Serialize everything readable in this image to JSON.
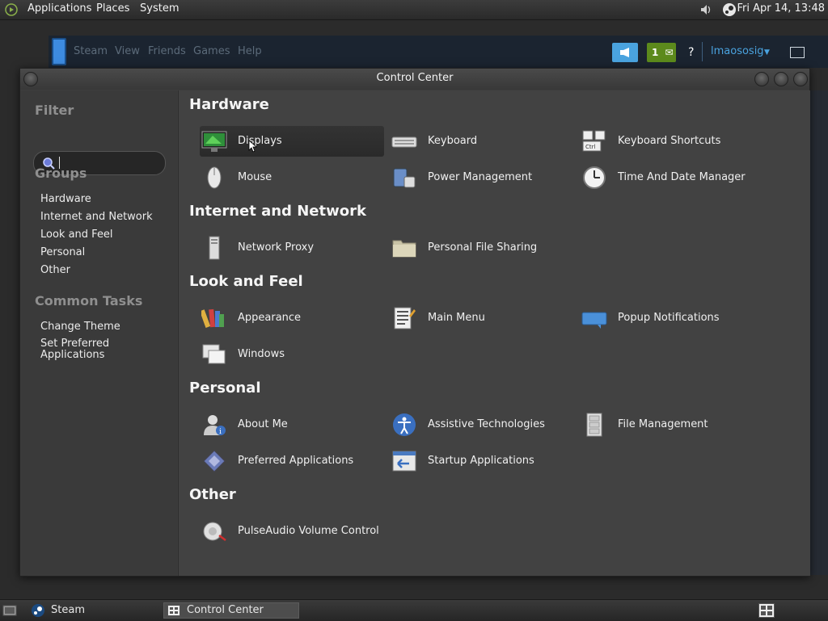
{
  "top_panel": {
    "menus": [
      "Applications",
      "Places",
      "System"
    ],
    "clock": "Fri Apr 14, 13:48"
  },
  "steam_window": {
    "menus": [
      "Steam",
      "View",
      "Friends",
      "Games",
      "Help"
    ],
    "notification_count": "1",
    "help": "?",
    "username": "lmaososig"
  },
  "window": {
    "title": "Control Center"
  },
  "sidebar": {
    "filter_heading": "Filter",
    "search": {
      "value": "",
      "placeholder": ""
    },
    "groups_heading": "Groups",
    "groups": [
      "Hardware",
      "Internet and Network",
      "Look and Feel",
      "Personal",
      "Other"
    ],
    "common_tasks_heading": "Common Tasks",
    "tasks": [
      "Change Theme",
      "Set Preferred Applications"
    ]
  },
  "sections": [
    {
      "title": "Hardware",
      "items": [
        {
          "label": "Displays",
          "icon": "monitor-icon"
        },
        {
          "label": "Keyboard",
          "icon": "keyboard-icon"
        },
        {
          "label": "Keyboard Shortcuts",
          "icon": "keyboard-shortcuts-icon"
        },
        {
          "label": "Mouse",
          "icon": "mouse-icon"
        },
        {
          "label": "Power Management",
          "icon": "power-icon"
        },
        {
          "label": "Time And Date Manager",
          "icon": "clock-icon"
        }
      ]
    },
    {
      "title": "Internet and Network",
      "items": [
        {
          "label": "Network Proxy",
          "icon": "network-proxy-icon"
        },
        {
          "label": "Personal File Sharing",
          "icon": "folder-share-icon"
        }
      ]
    },
    {
      "title": "Look and Feel",
      "items": [
        {
          "label": "Appearance",
          "icon": "appearance-icon"
        },
        {
          "label": "Main Menu",
          "icon": "main-menu-icon"
        },
        {
          "label": "Popup Notifications",
          "icon": "notification-icon"
        },
        {
          "label": "Windows",
          "icon": "windows-icon"
        }
      ]
    },
    {
      "title": "Personal",
      "items": [
        {
          "label": "About Me",
          "icon": "about-me-icon"
        },
        {
          "label": "Assistive Technologies",
          "icon": "accessibility-icon"
        },
        {
          "label": "File Management",
          "icon": "file-cabinet-icon"
        },
        {
          "label": "Preferred Applications",
          "icon": "preferred-apps-icon"
        },
        {
          "label": "Startup Applications",
          "icon": "startup-icon"
        }
      ]
    },
    {
      "title": "Other",
      "items": [
        {
          "label": "PulseAudio Volume Control",
          "icon": "volume-icon"
        }
      ]
    }
  ],
  "taskbar": {
    "tasks": [
      "Steam",
      "Control Center"
    ]
  },
  "colors": {
    "window_bg": "#424242",
    "sidebar_bg": "#3a3a3a",
    "steam_accent": "#4aa3df",
    "steam_green": "#5c8a1c"
  }
}
